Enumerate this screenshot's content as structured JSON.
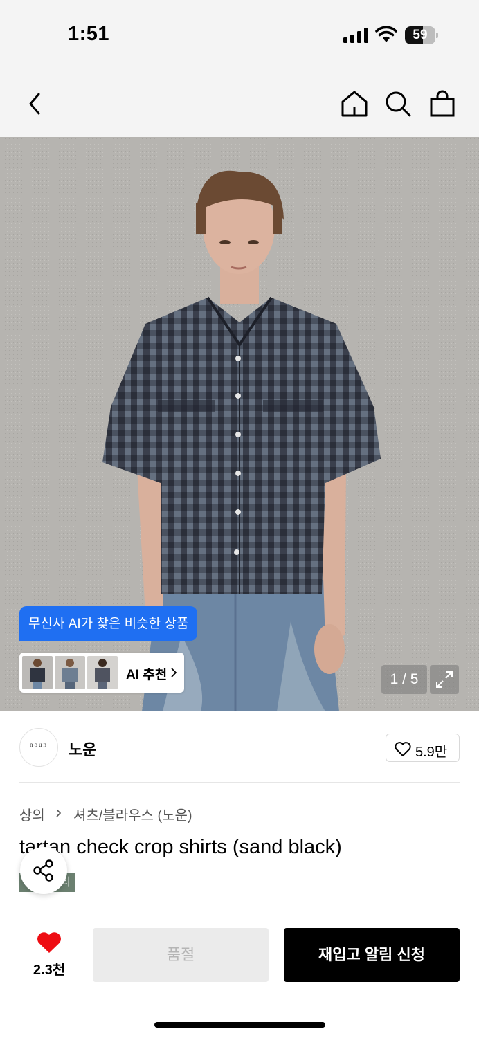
{
  "status_bar": {
    "time": "1:51",
    "battery_level": "59",
    "battery_fraction": 0.59
  },
  "nav": {
    "icons": [
      "chevron-left-icon",
      "home-icon",
      "search-icon",
      "shopping-bag-icon"
    ]
  },
  "gallery": {
    "ai_tooltip": "무신사 AI가 찾은 비슷한 상품",
    "ai_recommend_label": "AI 추천",
    "page_counter": "1 / 5",
    "current_page": 1,
    "total_pages": 5
  },
  "brand": {
    "logo_text": "noun",
    "name": "노운",
    "likes": "5.9만"
  },
  "product": {
    "breadcrumb": [
      "상의",
      "셔츠/블라우스 (노운)"
    ],
    "title": "tartan check crop shirts (sand black)",
    "tag_text": "티"
  },
  "bottom_bar": {
    "favorites": "2.3천",
    "soldout_label": "품절",
    "restock_label": "재입고 알림 신청"
  },
  "colors": {
    "accent_blue": "#1f6ff2",
    "heart_red": "#ee0d13",
    "badge_green": "#6b8070"
  }
}
